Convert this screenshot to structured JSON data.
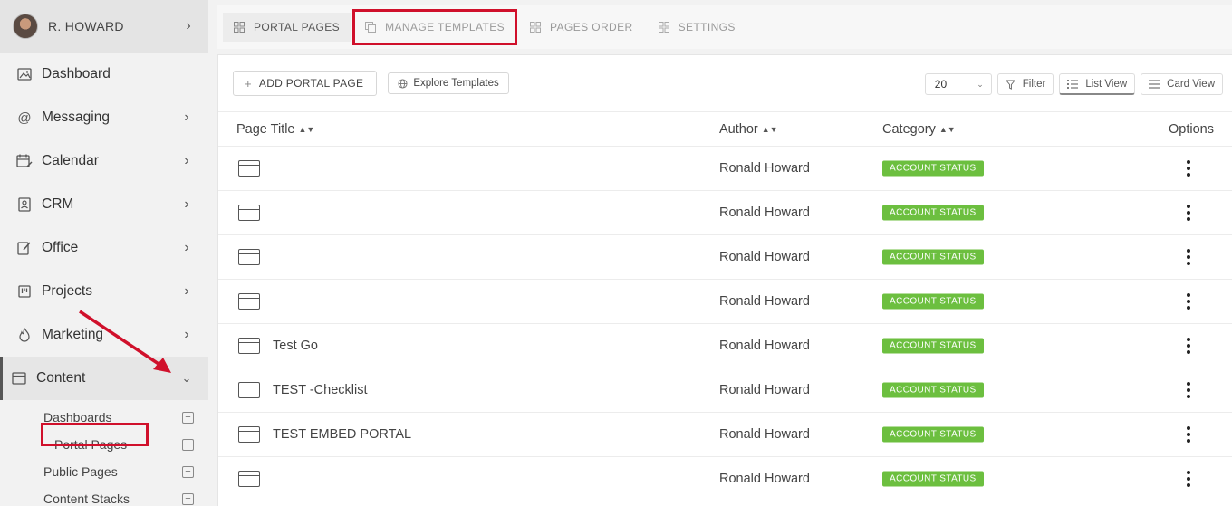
{
  "user": {
    "name": "R. HOWARD"
  },
  "sidebar": {
    "items": [
      {
        "label": "Dashboard",
        "icon": "image-icon",
        "chevron": ""
      },
      {
        "label": "Messaging",
        "icon": "at-icon",
        "chevron": "›"
      },
      {
        "label": "Calendar",
        "icon": "calendar-icon",
        "chevron": "›"
      },
      {
        "label": "CRM",
        "icon": "contact-icon",
        "chevron": "›"
      },
      {
        "label": "Office",
        "icon": "edit-icon",
        "chevron": "›"
      },
      {
        "label": "Projects",
        "icon": "kanban-icon",
        "chevron": "›"
      },
      {
        "label": "Marketing",
        "icon": "flame-icon",
        "chevron": "›"
      }
    ],
    "active": {
      "label": "Content",
      "icon": "window-icon",
      "chevron": "⌄"
    },
    "subitems": [
      "Dashboards",
      "Portal Pages",
      "Public Pages",
      "Content Stacks"
    ]
  },
  "tabs": [
    "PORTAL PAGES",
    "MANAGE TEMPLATES",
    "PAGES ORDER",
    "SETTINGS"
  ],
  "toolbar": {
    "add_label": "ADD PORTAL PAGE",
    "explore_label": "Explore Templates",
    "page_size": "20",
    "filter_label": "Filter",
    "list_view_label": "List View",
    "card_view_label": "Card View"
  },
  "table": {
    "headers": {
      "title": "Page Title",
      "author": "Author",
      "category": "Category",
      "options": "Options"
    },
    "rows": [
      {
        "title": "",
        "author": "Ronald Howard",
        "category": "ACCOUNT STATUS"
      },
      {
        "title": "",
        "author": "Ronald Howard",
        "category": "ACCOUNT STATUS"
      },
      {
        "title": "",
        "author": "Ronald Howard",
        "category": "ACCOUNT STATUS"
      },
      {
        "title": "",
        "author": "Ronald Howard",
        "category": "ACCOUNT STATUS"
      },
      {
        "title": "Test Go",
        "author": "Ronald Howard",
        "category": "ACCOUNT STATUS"
      },
      {
        "title": "TEST -Checklist",
        "author": "Ronald Howard",
        "category": "ACCOUNT STATUS"
      },
      {
        "title": "TEST EMBED PORTAL",
        "author": "Ronald Howard",
        "category": "ACCOUNT STATUS"
      },
      {
        "title": "",
        "author": "Ronald Howard",
        "category": "ACCOUNT STATUS"
      }
    ]
  },
  "colors": {
    "badge": "#6cbf3f",
    "highlight": "#d0102b"
  }
}
